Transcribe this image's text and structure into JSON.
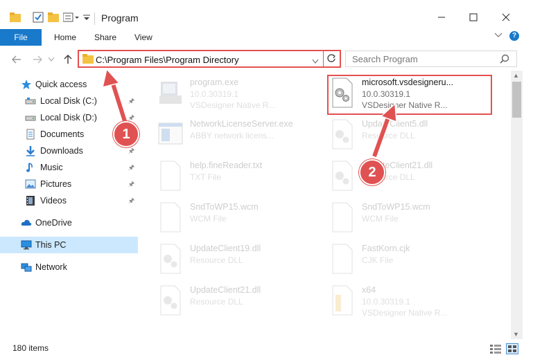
{
  "window": {
    "title": "Program"
  },
  "ribbon": {
    "tabs": [
      "File",
      "Home",
      "Share",
      "View"
    ]
  },
  "address": {
    "path": "C:\\Program Files\\Program Directory"
  },
  "search": {
    "placeholder": "Search Program"
  },
  "sidebar": {
    "items": [
      {
        "label": "Quick access",
        "icon": "star-icon",
        "pinned": false
      },
      {
        "label": "Local Disk (C:)",
        "icon": "drive-icon",
        "pinned": true
      },
      {
        "label": "Local Disk (D:)",
        "icon": "drive-icon",
        "pinned": true
      },
      {
        "label": "Documents",
        "icon": "documents-icon",
        "pinned": true
      },
      {
        "label": "Downloads",
        "icon": "download-icon",
        "pinned": true
      },
      {
        "label": "Music",
        "icon": "music-icon",
        "pinned": true
      },
      {
        "label": "Pictures",
        "icon": "pictures-icon",
        "pinned": true
      },
      {
        "label": "Videos",
        "icon": "videos-icon",
        "pinned": true
      },
      {
        "label": "OneDrive",
        "icon": "cloud-icon",
        "pinned": false
      },
      {
        "label": "This PC",
        "icon": "pc-icon",
        "pinned": false,
        "selected": true
      },
      {
        "label": "Network",
        "icon": "network-icon",
        "pinned": false
      }
    ]
  },
  "files": [
    {
      "name": "program.exe",
      "line1": "10.0.30319.1",
      "line2": "VSDesigner Native R...",
      "icon": "exe-icon"
    },
    {
      "name": "microsoft.vsdesigneru...",
      "line1": "10.0.30319.1",
      "line2": "VSDesigner Native R...",
      "icon": "dll-gear-icon"
    },
    {
      "name": "NetworkLicenseServer.exe",
      "line1": "ABBY network licens...",
      "line2": "",
      "icon": "app-window-icon"
    },
    {
      "name": "UpdateClient5.dll",
      "line1": "Resource DLL",
      "line2": "",
      "icon": "dll-gear-icon"
    },
    {
      "name": "help.fineReader.txt",
      "line1": "TXT File",
      "line2": "",
      "icon": "blank-file-icon"
    },
    {
      "name": "UpdateClient21.dll",
      "line1": "Resource DLL",
      "line2": "",
      "icon": "dll-gear-icon"
    },
    {
      "name": "SndToWP15.wcm",
      "line1": "WCM File",
      "line2": "",
      "icon": "blank-file-icon"
    },
    {
      "name": "SndToWP15.wcm",
      "line1": "WCM File",
      "line2": "",
      "icon": "blank-file-icon"
    },
    {
      "name": "UpdateClient19.dll",
      "line1": "Resource DLL",
      "line2": "",
      "icon": "dll-gear-icon"
    },
    {
      "name": "FastKorn.cjk",
      "line1": "CJK File",
      "line2": "",
      "icon": "blank-file-icon"
    },
    {
      "name": "UpdateClient21.dll",
      "line1": "Resource DLL",
      "line2": "",
      "icon": "dll-gear-icon"
    },
    {
      "name": "x64",
      "line1": "10.0.30319.1",
      "line2": "VSDesigner Native R...",
      "icon": "folder-file-icon"
    }
  ],
  "callouts": [
    "1",
    "2"
  ],
  "status": {
    "items_count": "180 items"
  },
  "colors": {
    "accent": "#1979ca",
    "highlight": "#e45050",
    "selected": "#cce8ff"
  }
}
